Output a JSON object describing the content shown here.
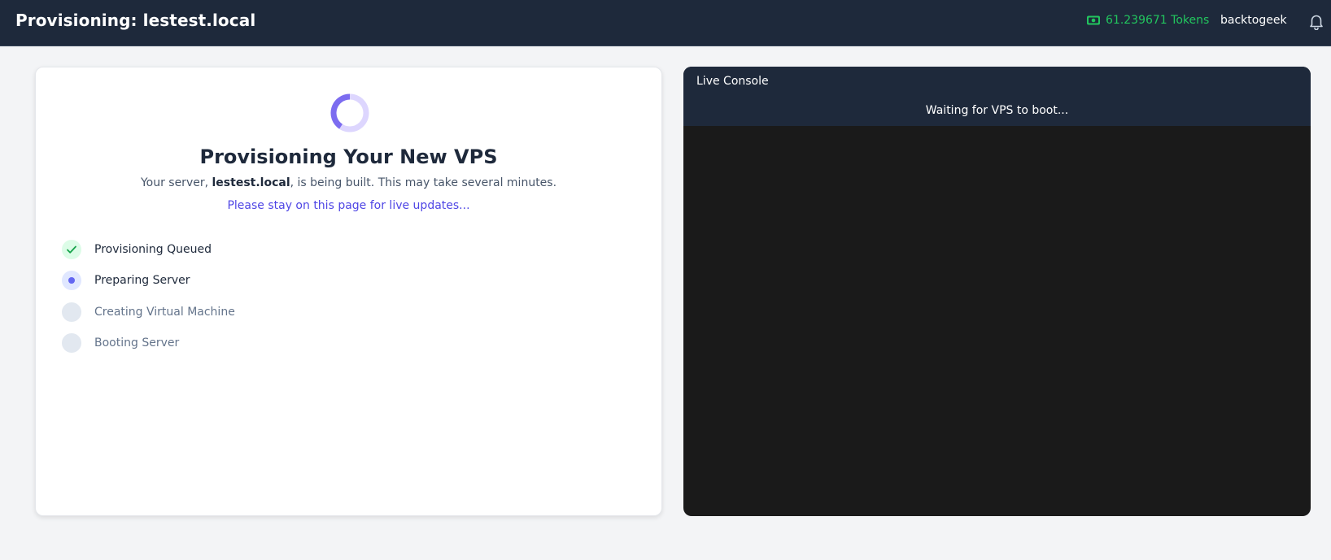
{
  "header": {
    "title": "Provisioning: lestest.local",
    "tokens": "61.239671 Tokens",
    "username": "backtogeek",
    "accent_token_color": "#22c55e"
  },
  "provision": {
    "heading": "Provisioning Your New VPS",
    "sub_prefix": "Your server, ",
    "server_name": "lestest.local",
    "sub_suffix": ", is being built. This may take several minutes.",
    "notice": "Please stay on this page for live updates..."
  },
  "steps": [
    {
      "label": "Provisioning Queued",
      "status": "done"
    },
    {
      "label": "Preparing Server",
      "status": "active"
    },
    {
      "label": "Creating Virtual Machine",
      "status": "pending"
    },
    {
      "label": "Booting Server",
      "status": "pending"
    }
  ],
  "console": {
    "title": "Live Console",
    "status": "Waiting for VPS to boot..."
  }
}
